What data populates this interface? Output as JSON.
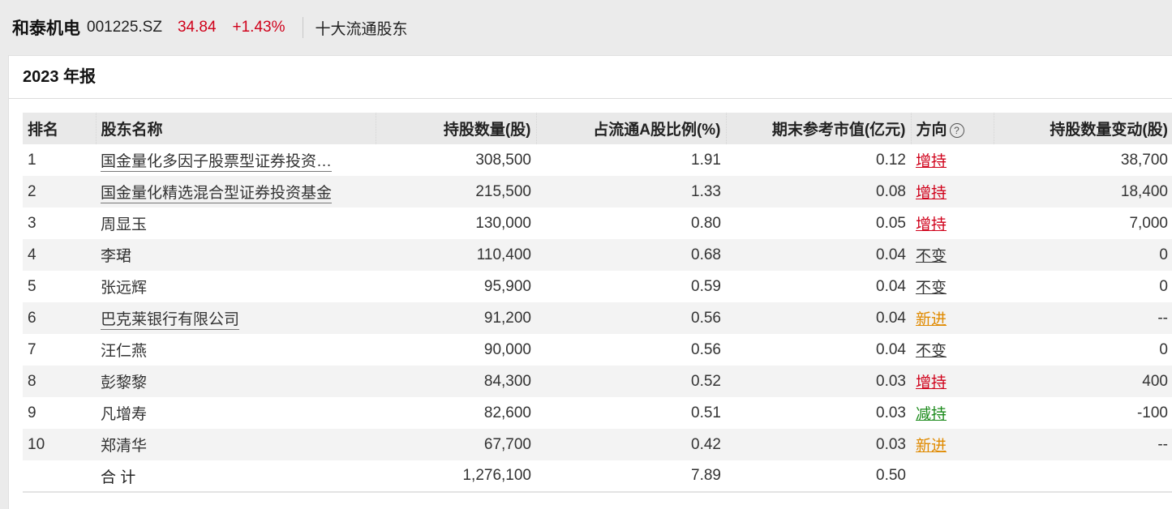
{
  "header": {
    "stock_name": "和泰机电",
    "stock_code": "001225.SZ",
    "price": "34.84",
    "change": "+1.43%",
    "section": "十大流通股东"
  },
  "panel": {
    "title": "2023 年报"
  },
  "table": {
    "columns": {
      "rank": "排名",
      "holder": "股东名称",
      "shares": "持股数量(股)",
      "ratio": "占流通A股比例(%)",
      "market_value": "期末参考市值(亿元)",
      "direction": "方向",
      "change": "持股数量变动(股)"
    },
    "help_icon": "?",
    "rows": [
      {
        "rank": "1",
        "holder": "国金量化多因子股票型证券投资…",
        "shares": "308,500",
        "ratio": "1.91",
        "market_value": "0.12",
        "direction": "增持",
        "change": "38,700"
      },
      {
        "rank": "2",
        "holder": "国金量化精选混合型证券投资基金",
        "shares": "215,500",
        "ratio": "1.33",
        "market_value": "0.08",
        "direction": "增持",
        "change": "18,400"
      },
      {
        "rank": "3",
        "holder": "周显玉",
        "shares": "130,000",
        "ratio": "0.80",
        "market_value": "0.05",
        "direction": "增持",
        "change": "7,000"
      },
      {
        "rank": "4",
        "holder": "李珺",
        "shares": "110,400",
        "ratio": "0.68",
        "market_value": "0.04",
        "direction": "不变",
        "change": "0"
      },
      {
        "rank": "5",
        "holder": "张远辉",
        "shares": "95,900",
        "ratio": "0.59",
        "market_value": "0.04",
        "direction": "不变",
        "change": "0"
      },
      {
        "rank": "6",
        "holder": "巴克莱银行有限公司",
        "shares": "91,200",
        "ratio": "0.56",
        "market_value": "0.04",
        "direction": "新进",
        "change": "--"
      },
      {
        "rank": "7",
        "holder": "汪仁燕",
        "shares": "90,000",
        "ratio": "0.56",
        "market_value": "0.04",
        "direction": "不变",
        "change": "0"
      },
      {
        "rank": "8",
        "holder": "彭黎黎",
        "shares": "84,300",
        "ratio": "0.52",
        "market_value": "0.03",
        "direction": "增持",
        "change": "400"
      },
      {
        "rank": "9",
        "holder": "凡增寿",
        "shares": "82,600",
        "ratio": "0.51",
        "market_value": "0.03",
        "direction": "减持",
        "change": "-100"
      },
      {
        "rank": "10",
        "holder": "郑清华",
        "shares": "67,700",
        "ratio": "0.42",
        "market_value": "0.03",
        "direction": "新进",
        "change": "--"
      }
    ],
    "total": {
      "label": "合 计",
      "shares": "1,276,100",
      "ratio": "7.89",
      "market_value": "0.50"
    }
  },
  "colors": {
    "up": "#d0021b",
    "down": "#1a8a1a",
    "new": "#e08a00",
    "neutral": "#333333"
  }
}
